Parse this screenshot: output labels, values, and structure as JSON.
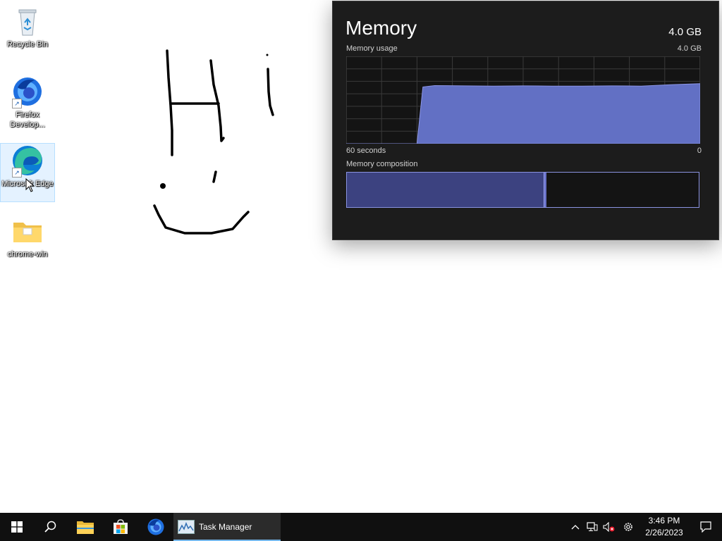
{
  "desktop": {
    "icons": [
      {
        "label": "Recycle Bin"
      },
      {
        "label": "Firefox Develop..."
      },
      {
        "label": "Microsoft Edge"
      },
      {
        "label": "chrome-win"
      }
    ],
    "drawing_text": "Hi :)"
  },
  "task_manager": {
    "title": "Memory",
    "total": "4.0 GB",
    "usage_label": "Memory usage",
    "usage_max": "4.0 GB",
    "x_left": "60 seconds",
    "x_right": "0",
    "composition_label": "Memory composition",
    "composition_in_use_fraction": 0.56,
    "accent": "#5c6bc0"
  },
  "chart_data": {
    "type": "area",
    "title": "Memory usage",
    "xlabel": "60 seconds",
    "ylabel": "",
    "xlim": [
      60,
      0
    ],
    "ylim": [
      0,
      4.0
    ],
    "series": [
      {
        "name": "Memory usage",
        "x": [
          60,
          48,
          47,
          45,
          40,
          35,
          30,
          25,
          20,
          15,
          10,
          5,
          0
        ],
        "values": [
          0,
          0,
          2.6,
          2.66,
          2.65,
          2.64,
          2.65,
          2.64,
          2.64,
          2.65,
          2.64,
          2.7,
          2.75
        ]
      }
    ]
  },
  "taskbar": {
    "start_icon": "windows-logo",
    "search_icon": "search-icon",
    "pinned": [
      {
        "name": "file-explorer-icon",
        "color": "#f5c84c"
      },
      {
        "name": "store-icon",
        "color": "#3a96dd"
      },
      {
        "name": "firefox-icon",
        "color": "#2f7ad9"
      }
    ],
    "active_app": {
      "label": "Task Manager"
    },
    "tray": {
      "chevron": "^",
      "time": "3:46 PM",
      "date": "2/26/2023"
    }
  }
}
